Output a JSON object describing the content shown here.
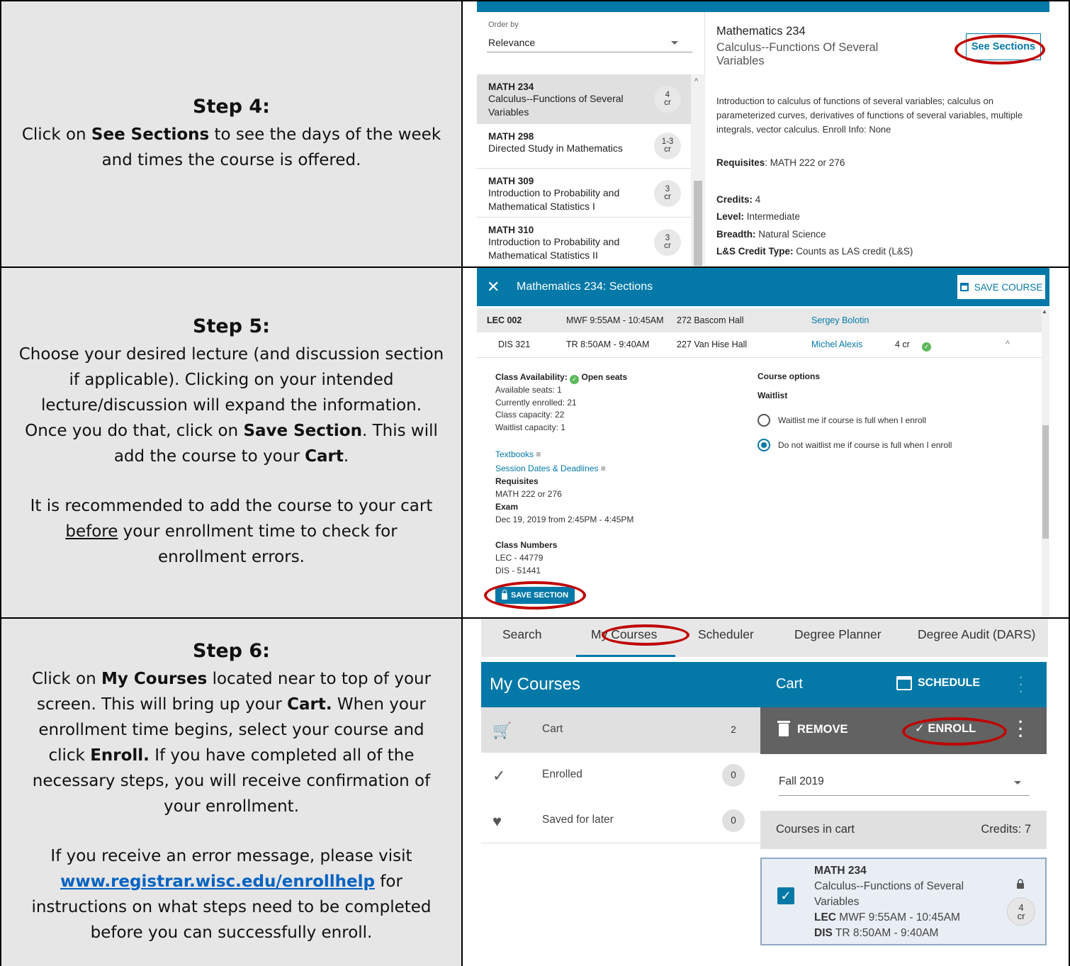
{
  "step4": {
    "heading": "Step 4:",
    "pre": "Click on ",
    "bold": "See Sections",
    "post": " to see the days of the week and times the course is offered."
  },
  "step5": {
    "heading": "Step 5:",
    "p1_a": "Choose your desired lecture (and discussion section if applicable). Clicking on your intended lecture/discussion will expand the information. Once you do that, click on ",
    "p1_b": "Save Section",
    "p1_c": ". This will add the course to your ",
    "p1_d": "Cart",
    "p1_e": ".",
    "p2_a": "It is recommended to add the course to your cart ",
    "p2_u": "before",
    "p2_b": " your enrollment time to check for enrollment errors."
  },
  "step6": {
    "heading": "Step 6:",
    "p1_a": "Click on ",
    "p1_b": "My Courses",
    "p1_c": " located near to top of your screen. This will bring up your ",
    "p1_d": "Cart.",
    "p1_e": " When your enrollment time begins, select your course and click ",
    "p1_f": "Enroll.",
    "p1_g": " If you have completed all of the necessary steps, you will receive confirmation of your enrollment.",
    "p2_a": "If you receive an error message, please visit ",
    "p2_link": "www.registrar.wisc.edu/enrollhelp",
    "p2_b": " for instructions on what steps need to be completed before you can successfully enroll."
  },
  "search_panel": {
    "order_label": "Order by",
    "order_value": "Relevance",
    "courses": [
      {
        "code": "MATH 234",
        "title": "Calculus--Functions of Several Variables",
        "cr": "4",
        "unit": "cr"
      },
      {
        "code": "MATH 298",
        "title": "Directed Study in Mathematics",
        "cr": "1-3",
        "unit": "cr"
      },
      {
        "code": "MATH 309",
        "title": "Introduction to Probability and Mathematical Statistics I",
        "cr": "3",
        "unit": "cr"
      },
      {
        "code": "MATH 310",
        "title": "Introduction to Probability and Mathematical Statistics II",
        "cr": "3",
        "unit": "cr"
      }
    ],
    "detail": {
      "title": "Mathematics 234",
      "subtitle": "Calculus--Functions Of Several Variables",
      "see_sections": "See Sections",
      "description": "Introduction to calculus of functions of several variables; calculus on parameterized curves, derivatives of functions of several variables, multiple integrals, vector calculus. Enroll Info: None",
      "requisites_label": "Requisites",
      "requisites_value": ": MATH 222 or 276",
      "credits_label": "Credits:",
      "credits_value": " 4",
      "level_label": "Level:",
      "level_value": " Intermediate",
      "breadth_label": "Breadth:",
      "breadth_value": " Natural Science",
      "ls_label": "L&S Credit Type:",
      "ls_value": " Counts as LAS credit (L&S)"
    }
  },
  "sections_panel": {
    "title": "Mathematics 234: Sections",
    "close": "✕",
    "save_course": "SAVE COURSE",
    "lec": {
      "section": "LEC 002",
      "time": "MWF 9:55AM - 10:45AM",
      "room": "272 Bascom Hall",
      "instructor": "Sergey Bolotin"
    },
    "dis": {
      "section": "DIS 321",
      "time": "TR 8:50AM - 9:40AM",
      "room": "227 Van Hise Hall",
      "instructor": "Michel Alexis",
      "cr": "4 cr",
      "collapse": "^"
    },
    "availability_label": "Class Availability:",
    "availability_value": "Open seats",
    "available_seats": "Available seats: 1",
    "currently_enrolled": "Currently enrolled: 21",
    "class_capacity": "Class capacity: 22",
    "waitlist_capacity": "Waitlist capacity: 1",
    "course_options": "Course options",
    "waitlist": "Waitlist",
    "opt1": "Waitlist me if course is full when I enroll",
    "opt2": "Do not waitlist me if course is full when I enroll",
    "textbooks": "Textbooks",
    "session_dates": "Session Dates & Deadlines",
    "list_glyph": "≡",
    "requisites_label": "Requisites",
    "requisites_value": "MATH 222 or 276",
    "exam_label": "Exam",
    "exam_value": "Dec 19, 2019 from 2:45PM - 4:45PM",
    "class_numbers_label": "Class Numbers",
    "lec_num": "LEC - 44779",
    "dis_num": "DIS - 51441",
    "save_section": "SAVE SECTION"
  },
  "mycourses_panel": {
    "tabs": [
      "Search",
      "My Courses",
      "Scheduler",
      "Degree Planner",
      "Degree Audit (DARS)"
    ],
    "left_title": "My Courses",
    "items": [
      {
        "label": "Cart",
        "count": "2",
        "icon": "cart-icon"
      },
      {
        "label": "Enrolled",
        "count": "0",
        "icon": "check-icon"
      },
      {
        "label": "Saved for later",
        "count": "0",
        "icon": "heart-icon"
      }
    ],
    "cart_title": "Cart",
    "schedule": "SCHEDULE",
    "remove": "REMOVE",
    "enroll": "✓ ENROLL",
    "term": "Fall 2019",
    "courses_in_cart": "Courses in cart",
    "credits": "Credits: 7",
    "course_code": "MATH 234",
    "course_title_1": "Calculus--Functions of Several",
    "course_title_2": "Variables",
    "lec_label": "LEC",
    "lec_time": " MWF 9:55AM - 10:45AM",
    "dis_label": "DIS",
    "dis_time": " TR 8:50AM - 9:40AM",
    "cr": "4",
    "cr_unit": "cr"
  },
  "colors": {
    "accent": "#0479a8",
    "highlight_circle": "#c00000",
    "cell_bg": "#e7e6e6",
    "link": "#0563c1"
  }
}
